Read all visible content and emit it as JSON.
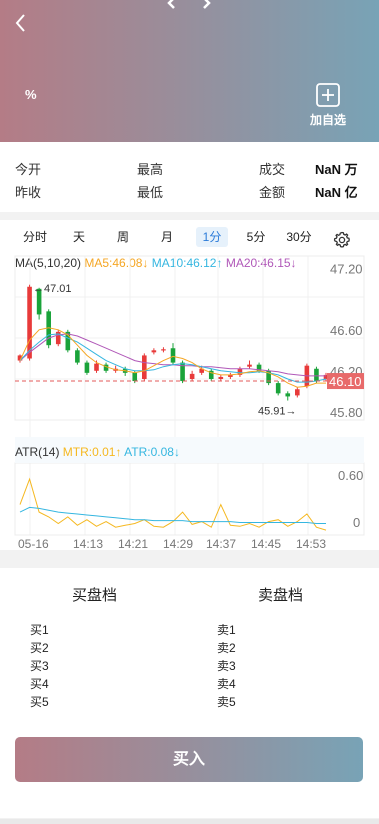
{
  "header": {
    "percent": "%",
    "favorite_label": "加自选",
    "colors": {
      "gradient_start": "#b47c86",
      "gradient_end": "#78a3b6"
    }
  },
  "quote": {
    "open_label": "今开",
    "prev_close_label": "昨收",
    "high_label": "最高",
    "low_label": "最低",
    "volume_label": "成交",
    "amount_label": "金额",
    "volume_value": "NaN 万",
    "amount_value": "NaN 亿"
  },
  "tabs": [
    "分时",
    "天",
    "周",
    "月",
    "1分",
    "5分",
    "30分"
  ],
  "active_tab": "1分",
  "indicators": {
    "ma_title": "MA(5,10,20)",
    "ma5": "MA5:46.08↓",
    "ma10": "MA10:46.12↑",
    "ma20": "MA20:46.15↓",
    "atr_title": "ATR(14)",
    "mtr": "MTR:0.01↑",
    "atr": "ATR:0.08↓",
    "colors": {
      "ma5": "#f5a623",
      "ma10": "#35b6e0",
      "ma20": "#b058b8"
    }
  },
  "chart_data": {
    "type": "candlestick",
    "y_ticks": [
      "47.20",
      "46.60",
      "46.20",
      "45.80"
    ],
    "ylim": [
      45.72,
      47.32
    ],
    "x_ticks": [
      "05-16",
      "14:13",
      "14:21",
      "14:29",
      "14:37",
      "14:45",
      "14:53"
    ],
    "current_price": "46.10",
    "max_label": "←47.01",
    "min_label": "45.91→",
    "atr_ticks": [
      "0.60",
      "0"
    ],
    "candles": [
      {
        "o": 46.3,
        "c": 46.35,
        "h": 46.36,
        "l": 46.28
      },
      {
        "o": 46.32,
        "c": 47.02,
        "h": 47.04,
        "l": 46.3
      },
      {
        "o": 47.0,
        "c": 46.75,
        "h": 47.01,
        "l": 46.7
      },
      {
        "o": 46.78,
        "c": 46.45,
        "h": 46.8,
        "l": 46.42
      },
      {
        "o": 46.46,
        "c": 46.58,
        "h": 46.6,
        "l": 46.44
      },
      {
        "o": 46.58,
        "c": 46.4,
        "h": 46.6,
        "l": 46.38
      },
      {
        "o": 46.4,
        "c": 46.28,
        "h": 46.42,
        "l": 46.26
      },
      {
        "o": 46.28,
        "c": 46.18,
        "h": 46.3,
        "l": 46.16
      },
      {
        "o": 46.2,
        "c": 46.27,
        "h": 46.3,
        "l": 46.18
      },
      {
        "o": 46.26,
        "c": 46.2,
        "h": 46.28,
        "l": 46.18
      },
      {
        "o": 46.2,
        "c": 46.22,
        "h": 46.25,
        "l": 46.18
      },
      {
        "o": 46.22,
        "c": 46.18,
        "h": 46.24,
        "l": 46.15
      },
      {
        "o": 46.18,
        "c": 46.1,
        "h": 46.2,
        "l": 46.08
      },
      {
        "o": 46.12,
        "c": 46.35,
        "h": 46.37,
        "l": 46.1
      },
      {
        "o": 46.38,
        "c": 46.4,
        "h": 46.42,
        "l": 46.36
      },
      {
        "o": 46.4,
        "c": 46.41,
        "h": 46.43,
        "l": 46.38
      },
      {
        "o": 46.42,
        "c": 46.28,
        "h": 46.47,
        "l": 46.26
      },
      {
        "o": 46.28,
        "c": 46.1,
        "h": 46.3,
        "l": 46.08
      },
      {
        "o": 46.12,
        "c": 46.17,
        "h": 46.2,
        "l": 46.1
      },
      {
        "o": 46.18,
        "c": 46.22,
        "h": 46.25,
        "l": 46.16
      },
      {
        "o": 46.2,
        "c": 46.12,
        "h": 46.22,
        "l": 46.1
      },
      {
        "o": 46.12,
        "c": 46.14,
        "h": 46.16,
        "l": 46.1
      },
      {
        "o": 46.14,
        "c": 46.16,
        "h": 46.18,
        "l": 46.12
      },
      {
        "o": 46.16,
        "c": 46.22,
        "h": 46.24,
        "l": 46.14
      },
      {
        "o": 46.24,
        "c": 46.26,
        "h": 46.3,
        "l": 46.22
      },
      {
        "o": 46.26,
        "c": 46.2,
        "h": 46.28,
        "l": 46.18
      },
      {
        "o": 46.2,
        "c": 46.08,
        "h": 46.22,
        "l": 46.06
      },
      {
        "o": 46.08,
        "c": 45.98,
        "h": 46.1,
        "l": 45.96
      },
      {
        "o": 45.98,
        "c": 45.95,
        "h": 46.0,
        "l": 45.91
      },
      {
        "o": 45.96,
        "c": 46.02,
        "h": 46.04,
        "l": 45.94
      },
      {
        "o": 46.05,
        "c": 46.25,
        "h": 46.27,
        "l": 46.03
      },
      {
        "o": 46.22,
        "c": 46.1,
        "h": 46.24,
        "l": 46.08
      },
      {
        "o": 46.12,
        "c": 46.16,
        "h": 46.18,
        "l": 46.1
      }
    ],
    "ma5": [
      46.3,
      46.5,
      46.6,
      46.62,
      46.6,
      46.55,
      46.45,
      46.35,
      46.28,
      46.24,
      46.21,
      46.2,
      46.18,
      46.2,
      46.25,
      46.3,
      46.34,
      46.32,
      46.28,
      46.22,
      46.18,
      46.16,
      46.16,
      46.17,
      46.19,
      46.2,
      46.18,
      46.14,
      46.08,
      46.04,
      46.05,
      46.08,
      46.08
    ],
    "ma10": [
      46.3,
      46.4,
      46.48,
      46.55,
      46.56,
      46.52,
      46.48,
      46.42,
      46.36,
      46.3,
      46.26,
      46.22,
      46.2,
      46.2,
      46.21,
      46.24,
      46.26,
      46.27,
      46.26,
      46.24,
      46.22,
      46.2,
      46.19,
      46.18,
      46.18,
      46.19,
      46.18,
      46.16,
      46.12,
      46.09,
      46.09,
      46.1,
      46.12
    ],
    "ma20": [
      46.3,
      46.38,
      46.45,
      46.52,
      46.55,
      46.56,
      46.54,
      46.5,
      46.46,
      46.42,
      46.38,
      46.34,
      46.3,
      46.28,
      46.27,
      46.26,
      46.26,
      46.25,
      46.25,
      46.24,
      46.24,
      46.23,
      46.22,
      46.22,
      46.22,
      46.21,
      46.2,
      46.19,
      46.17,
      46.16,
      46.15,
      46.15,
      46.15
    ],
    "mtr": [
      0.28,
      0.55,
      0.2,
      0.15,
      0.08,
      0.15,
      0.06,
      0.12,
      0.05,
      0.1,
      0.04,
      0.06,
      0.08,
      0.12,
      0.05,
      0.04,
      0.1,
      0.2,
      0.07,
      0.1,
      0.04,
      0.28,
      0.06,
      0.05,
      0.08,
      0.04,
      0.1,
      0.12,
      0.05,
      0.1,
      0.18,
      0.04,
      0.01
    ],
    "atr_series": [
      0.2,
      0.25,
      0.24,
      0.22,
      0.2,
      0.19,
      0.18,
      0.17,
      0.16,
      0.15,
      0.14,
      0.13,
      0.12,
      0.12,
      0.11,
      0.11,
      0.11,
      0.11,
      0.1,
      0.1,
      0.1,
      0.1,
      0.1,
      0.09,
      0.09,
      0.09,
      0.09,
      0.09,
      0.09,
      0.09,
      0.09,
      0.08,
      0.08
    ],
    "colors": {
      "up": "#e83a3a",
      "down": "#1aa33a",
      "last_price_bg": "#e86a6a",
      "mtr": "#f5b820",
      "atr": "#35b6e0"
    }
  },
  "orderbook": {
    "buy_title": "买盘档",
    "sell_title": "卖盘档",
    "buys": [
      "买1",
      "买2",
      "买3",
      "买4",
      "买5"
    ],
    "sells": [
      "卖1",
      "卖2",
      "卖3",
      "卖4",
      "卖5"
    ]
  },
  "buy_button": "买入"
}
